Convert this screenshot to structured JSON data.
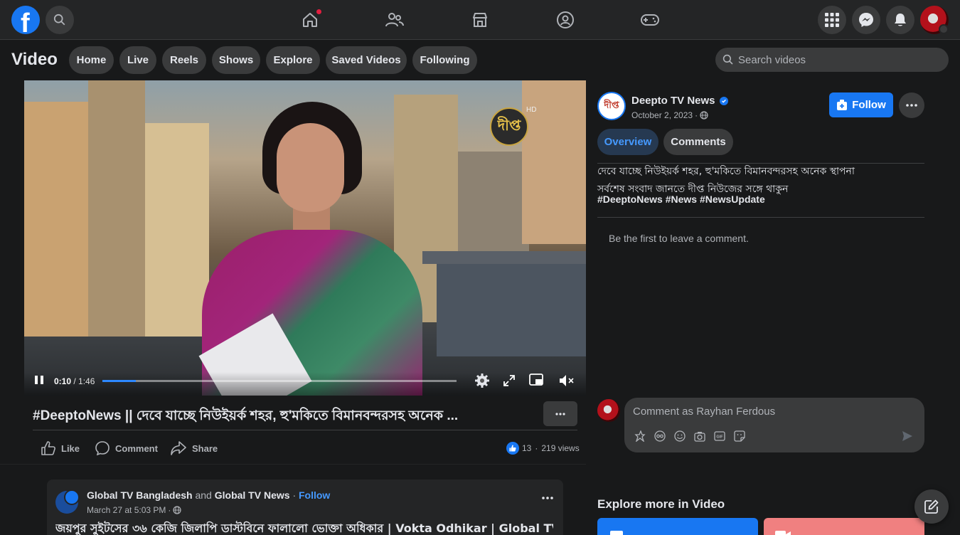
{
  "topbar": {
    "logo": "f",
    "search_icon": "search-icon",
    "nav_icons": [
      "home-icon",
      "friends-icon",
      "marketplace-icon",
      "groups-icon",
      "gaming-icon"
    ],
    "right_icons": [
      "menu-grid-icon",
      "messenger-icon",
      "notifications-icon"
    ]
  },
  "video_header": {
    "title": "Video",
    "tabs": [
      "Home",
      "Live",
      "Reels",
      "Shows",
      "Explore",
      "Saved Videos",
      "Following"
    ],
    "search_placeholder": "Search videos"
  },
  "player": {
    "watermark": "দীপ্ত",
    "watermark_hd": "HD",
    "current_time": "0:10",
    "separator": " / ",
    "duration": "1:46",
    "progress": 0.094
  },
  "post": {
    "title": "#DeeptoNews || দেবে যাচ্ছে নিউইয়র্ক শহর, হু'মকিতে বিমানবন্দরসহ অনেক ...",
    "actions": {
      "like": "Like",
      "comment": "Comment",
      "share": "Share"
    },
    "reactions": "13",
    "views": "219 views",
    "views_separator": "·"
  },
  "details": {
    "page_avatar_text": "দীপ্ত",
    "page_name": "Deepto TV News",
    "date": "October 2, 2023",
    "date_separator": "·",
    "follow_label": "Follow",
    "tabs": {
      "overview": "Overview",
      "comments": "Comments"
    },
    "desc_line1": "দেবে যাচ্ছে নিউইয়র্ক শহর, হু'মকিতে বিমানবন্দরসহ অনেক স্থাপনা",
    "desc_line2": "সর্বশেষ সংবাদ জানতে দীপ্ত নিউজের সঙ্গে থাকুন",
    "hashtags": "#DeeptoNews #News #NewsUpdate",
    "empty_comments": "Be the first to leave a comment.",
    "comment_placeholder": "Comment as Rayhan Ferdous"
  },
  "feed": {
    "page1": "Global TV Bangladesh",
    "and": "and",
    "page2": "Global TV News",
    "dot": "·",
    "follow": "Follow",
    "date": "March 27 at 5:03 PM",
    "date_separator": "·",
    "title": "জয়পুর সুইটসের ৩৬ কেজি জিলাপি ডাস্টবিনে ফালালো ভোক্তা অধিকার | Vokta Odhikar | Global TV"
  },
  "explore": {
    "title": "Explore more in Video"
  },
  "colors": {
    "accent": "#1877f2",
    "background": "#18191a",
    "surface": "#242526"
  }
}
